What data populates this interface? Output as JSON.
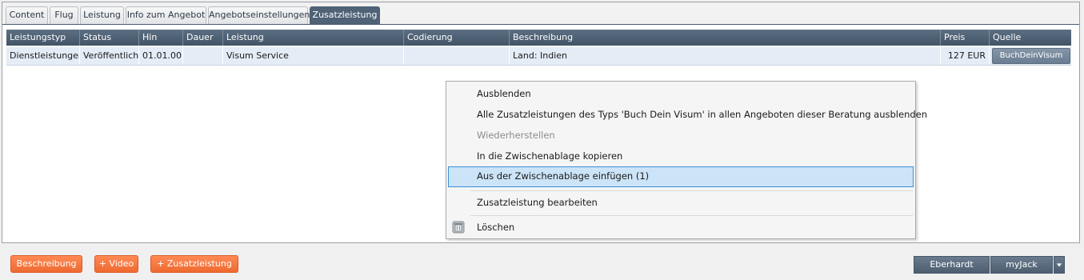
{
  "tabs": [
    {
      "label": "Content",
      "active": false
    },
    {
      "label": "Flug",
      "active": false
    },
    {
      "label": "Leistung",
      "active": false
    },
    {
      "label": "Info zum Angebot",
      "active": false
    },
    {
      "label": "Angebotseinstellungen",
      "active": false
    },
    {
      "label": "Zusatzleistung",
      "active": true
    }
  ],
  "table": {
    "headers": {
      "leistungstyp": "Leistungstyp",
      "status": "Status",
      "hin": "Hin",
      "dauer": "Dauer",
      "leistung": "Leistung",
      "codierung": "Codierung",
      "beschreibung": "Beschreibung",
      "preis": "Preis",
      "quelle": "Quelle"
    },
    "row": {
      "leistungstyp": "Dienstleistungen",
      "status": "Veröffentlicht",
      "hin": "01.01.00",
      "dauer": "",
      "leistung": "Visum Service",
      "codierung": "",
      "beschreibung": "Land: Indien",
      "preis": "127 EUR",
      "quelle": "BuchDeinVisum"
    }
  },
  "context_menu": {
    "items": [
      {
        "label": "Ausblenden",
        "state": "normal"
      },
      {
        "label": "Alle Zusatzleistungen des Typs 'Buch Dein Visum' in allen Angeboten dieser Beratung ausblenden",
        "state": "normal"
      },
      {
        "label": "Wiederherstellen",
        "state": "disabled"
      },
      {
        "label": "In die Zwischenablage kopieren",
        "state": "normal"
      },
      {
        "label": "Aus der Zwischenablage einfügen (1)",
        "state": "hover"
      },
      {
        "label": "Zusatzleistung bearbeiten",
        "state": "normal"
      },
      {
        "label": "Löschen",
        "state": "normal",
        "icon": "trash-icon"
      }
    ]
  },
  "footer": {
    "beschreibung_label": "Beschreibung",
    "video_label": "+ Video",
    "zusatzleistung_label": "+ Zusatzleistung",
    "user_label": "Eberhardt",
    "app_label": "myJack",
    "dropdown_icon": "caret-down-icon"
  },
  "colors": {
    "tab_active": "#4f6276",
    "header_bg": "#4f6276",
    "row_bg": "#e4ecf6",
    "menu_hover": "#cce4f7",
    "menu_hover_border": "#3c8fd6",
    "orange_button": "#f47a40",
    "gray_button": "#56687a"
  }
}
